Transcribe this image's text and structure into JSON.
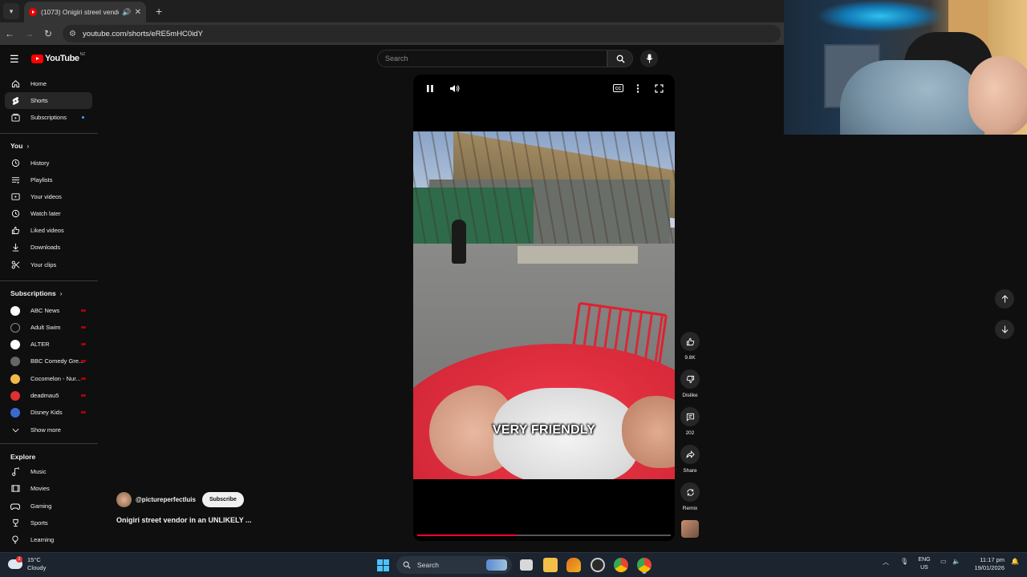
{
  "browser": {
    "tab_title": "(1073) Onigiri street vendo",
    "url": "youtube.com/shorts/eRE5mHC0idY"
  },
  "youtube": {
    "logo_text": "YouTube",
    "country_code": "NZ",
    "search_placeholder": "Search"
  },
  "sidebar": {
    "main": [
      {
        "label": "Home",
        "icon": "home-icon"
      },
      {
        "label": "Shorts",
        "icon": "shorts-icon"
      },
      {
        "label": "Subscriptions",
        "icon": "subscriptions-icon"
      }
    ],
    "you_heading": "You",
    "you_items": [
      {
        "label": "History",
        "icon": "history-icon"
      },
      {
        "label": "Playlists",
        "icon": "playlists-icon"
      },
      {
        "label": "Your videos",
        "icon": "your-videos-icon"
      },
      {
        "label": "Watch later",
        "icon": "watch-later-icon"
      },
      {
        "label": "Liked videos",
        "icon": "liked-videos-icon"
      },
      {
        "label": "Downloads",
        "icon": "downloads-icon"
      },
      {
        "label": "Your clips",
        "icon": "clips-icon"
      }
    ],
    "subs_heading": "Subscriptions",
    "subs": [
      {
        "label": "ABC News",
        "color": "#ffffff"
      },
      {
        "label": "Adult Swim",
        "color": "#111111"
      },
      {
        "label": "ALTER",
        "color": "#ffffff"
      },
      {
        "label": "BBC Comedy Gre...",
        "color": "#666666"
      },
      {
        "label": "Cocomelon - Nur...",
        "color": "#f2b94a"
      },
      {
        "label": "deadmau5",
        "color": "#e03030"
      },
      {
        "label": "Disney Kids",
        "color": "#3a6ad0"
      }
    ],
    "show_more": "Show more",
    "explore_heading": "Explore",
    "explore": [
      {
        "label": "Music",
        "icon": "music-icon"
      },
      {
        "label": "Movies",
        "icon": "movies-icon"
      },
      {
        "label": "Gaming",
        "icon": "gaming-icon"
      },
      {
        "label": "Sports",
        "icon": "sports-icon"
      },
      {
        "label": "Learning",
        "icon": "learning-icon"
      }
    ]
  },
  "player": {
    "caption": "VERY FRIENDLY",
    "progress": 0.39
  },
  "actions": {
    "likes": "9.8K",
    "dislike": "Dislike",
    "comments": "202",
    "share": "Share",
    "remix": "Remix"
  },
  "video_info": {
    "handle": "@pictureperfectluis",
    "subscribe": "Subscribe",
    "title": "Onigiri street vendor in an UNLIKELY ..."
  },
  "taskbar": {
    "temp": "15°C",
    "condition": "Cloudy",
    "weather_badge": "2",
    "search": "Search",
    "lang1": "ENG",
    "lang2": "US",
    "time": "11:17 pm",
    "date": "19/01/2026"
  }
}
